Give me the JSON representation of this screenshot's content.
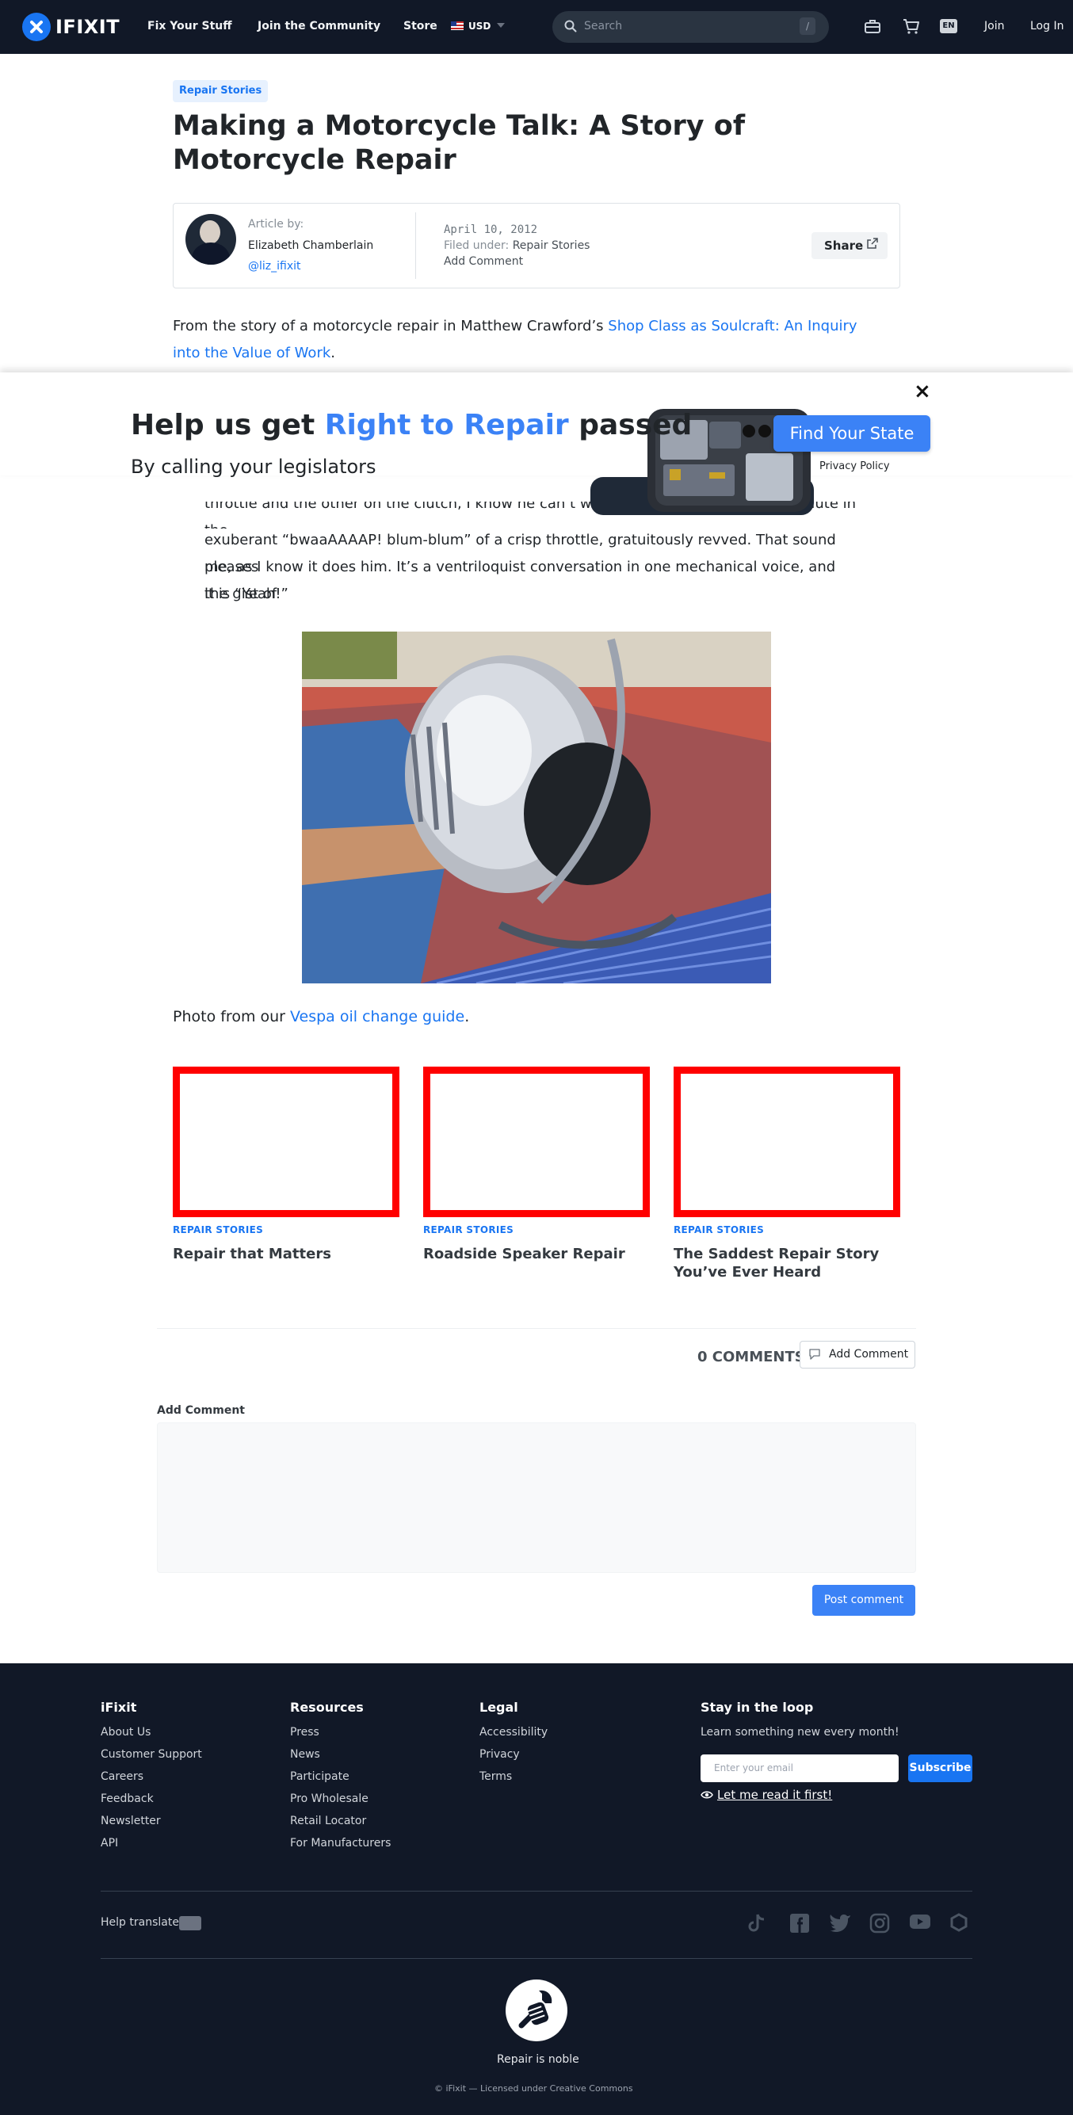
{
  "nav": {
    "logo": "IFIXIT",
    "links": [
      "Fix Your Stuff",
      "Join the Community",
      "Store"
    ],
    "currency": "USD",
    "search_placeholder": "Search",
    "search_shortcut": "/",
    "language": "EN",
    "join": "Join",
    "login": "Log In"
  },
  "article": {
    "category": "Repair Stories",
    "title": "Making a Motorcycle Talk: A Story of Motorcycle Repair",
    "byline_label": "Article by:",
    "author": "Elizabeth Chamberlain",
    "handle": "@liz_ifixit",
    "date": "April 10, 2012",
    "filed_label": "Filed under:",
    "filed_value": "Repair Stories",
    "add_comment": "Add Comment",
    "share": "Share",
    "intro_prefix": "From the story of a motorcycle repair in Matthew Crawford’s ",
    "intro_link": "Shop Class as Soulcraft: An Inquiry into the Value of Work",
    "intro_suffix": ".",
    "quote_partial": "throttle and the other on the clutch, I know he can’t wave back. But I can hear his salute in the",
    "quote_lines": [
      "exuberant “bwaaAAAAP! blum-blum” of a crisp throttle, gratuitously revved. That sound pleases",
      "me, as I know it does him. It’s a ventriloquist conversation in one mechanical voice, and the gist of",
      "it is “Yeah!”"
    ],
    "caption_prefix": "Photo from our ",
    "caption_link": "Vespa oil change guide",
    "caption_suffix": "."
  },
  "banner": {
    "close": "×",
    "headline_prefix": "Help us get ",
    "headline_highlight": "Right to Repair",
    "headline_suffix": " passed",
    "subheadline": "By calling your legislators",
    "cta": "Find Your State",
    "privacy": "Privacy Policy"
  },
  "related": [
    {
      "category": "REPAIR STORIES",
      "title": "Repair that Matters"
    },
    {
      "category": "REPAIR STORIES",
      "title": "Roadside Speaker Repair"
    },
    {
      "category": "REPAIR STORIES",
      "title": "The Saddest Repair Story You’ve Ever Heard"
    }
  ],
  "comments": {
    "count_label": "0 COMMENTS",
    "add_button": "Add Comment",
    "form_label": "Add Comment",
    "post_button": "Post comment"
  },
  "footer": {
    "columns": [
      {
        "heading": "iFixit",
        "links": [
          "About Us",
          "Customer Support",
          "Careers",
          "Feedback",
          "Newsletter",
          "API"
        ]
      },
      {
        "heading": "Resources",
        "links": [
          "Press",
          "News",
          "Participate",
          "Pro Wholesale",
          "Retail Locator",
          "For Manufacturers"
        ]
      },
      {
        "heading": "Legal",
        "links": [
          "Accessibility",
          "Privacy",
          "Terms"
        ]
      }
    ],
    "newsletter": {
      "heading": "Stay in the loop",
      "text": "Learn something new every month!",
      "email_placeholder": "Enter your email",
      "subscribe": "Subscribe",
      "read_first": "Let me read it first!"
    },
    "help_translate": "Help translate",
    "social_icons": [
      "tiktok-icon",
      "facebook-icon",
      "twitter-icon",
      "instagram-icon",
      "youtube-icon",
      "hexagon-icon"
    ],
    "tagline": "Repair is noble",
    "license": "© iFixit — Licensed under Creative Commons"
  },
  "colors": {
    "accent": "#1975f2",
    "banner_accent": "#3b82f6",
    "nav_bg": "#111827",
    "card_border": "#ff0000"
  }
}
